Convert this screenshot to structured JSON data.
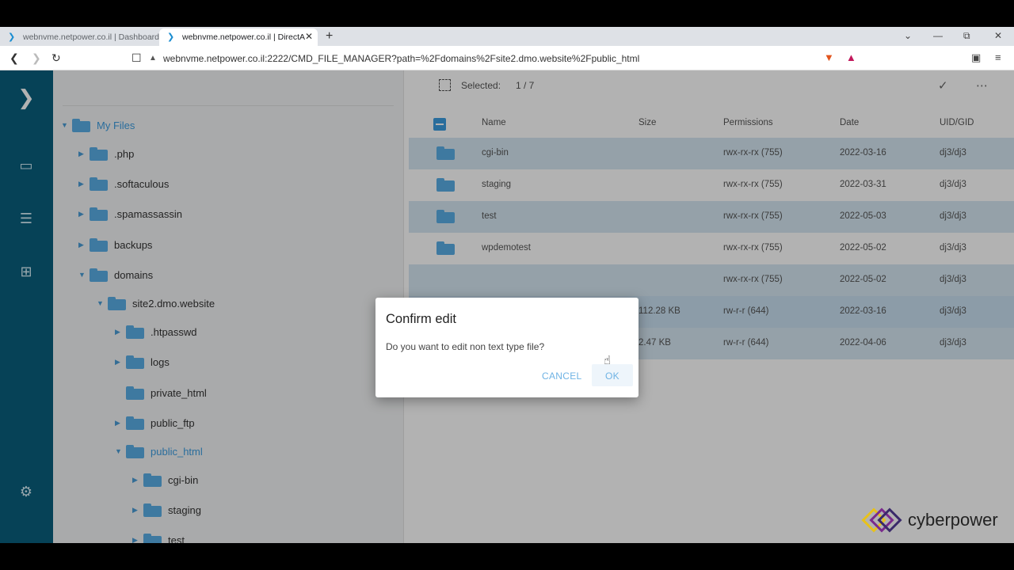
{
  "tabs": [
    {
      "title": "webnvme.netpower.co.il | Dashboard",
      "active": false
    },
    {
      "title": "webnvme.netpower.co.il | DirectA",
      "active": true
    }
  ],
  "address": {
    "url": "webnvme.netpower.co.il:2222/CMD_FILE_MANAGER?path=%2Fdomains%2Fsite2.dmo.website%2Fpublic_html"
  },
  "tree": {
    "root_label": "My Files",
    "nodes": [
      {
        "label": ".php"
      },
      {
        "label": ".softaculous"
      },
      {
        "label": ".spamassassin"
      },
      {
        "label": "backups"
      },
      {
        "label": "domains"
      },
      {
        "label": "site2.dmo.website"
      },
      {
        "label": ".htpasswd"
      },
      {
        "label": "logs"
      },
      {
        "label": "private_html"
      },
      {
        "label": "public_ftp"
      },
      {
        "label": "public_html"
      },
      {
        "label": "cgi-bin"
      },
      {
        "label": "staging"
      },
      {
        "label": "test"
      }
    ]
  },
  "toolbar": {
    "selected_label": "Selected:",
    "selected_count": "1 / 7"
  },
  "table": {
    "headers": {
      "name": "Name",
      "size": "Size",
      "permissions": "Permissions",
      "date": "Date",
      "uid": "UID/GID"
    },
    "rows": [
      {
        "name": "cgi-bin",
        "size": "",
        "perm": "rwx-rx-rx (755)",
        "date": "2022-03-16",
        "uid": "dj3/dj3"
      },
      {
        "name": "staging",
        "size": "",
        "perm": "rwx-rx-rx (755)",
        "date": "2022-03-31",
        "uid": "dj3/dj3"
      },
      {
        "name": "test",
        "size": "",
        "perm": "rwx-rx-rx (755)",
        "date": "2022-05-03",
        "uid": "dj3/dj3"
      },
      {
        "name": "wpdemotest",
        "size": "",
        "perm": "rwx-rx-rx (755)",
        "date": "2022-05-02",
        "uid": "dj3/dj3"
      },
      {
        "name": "",
        "size": "",
        "perm": "rwx-rx-rx (755)",
        "date": "2022-05-02",
        "uid": "dj3/dj3"
      },
      {
        "name": "",
        "size": "112.28 KB",
        "perm": "rw-r-r (644)",
        "date": "2022-03-16",
        "uid": "dj3/dj3"
      },
      {
        "name": "",
        "size": "2.47 KB",
        "perm": "rw-r-r (644)",
        "date": "2022-04-06",
        "uid": "dj3/dj3"
      }
    ]
  },
  "dialog": {
    "title": "Confirm edit",
    "message": "Do you want to edit non text type file?",
    "cancel": "CANCEL",
    "ok": "OK"
  },
  "brand": {
    "name": "cyberpower"
  },
  "colors": {
    "rail": "#0a5f7d",
    "accent": "#3c9de0",
    "folder": "#5aaee6",
    "selected_row": "#d6e7f3"
  }
}
